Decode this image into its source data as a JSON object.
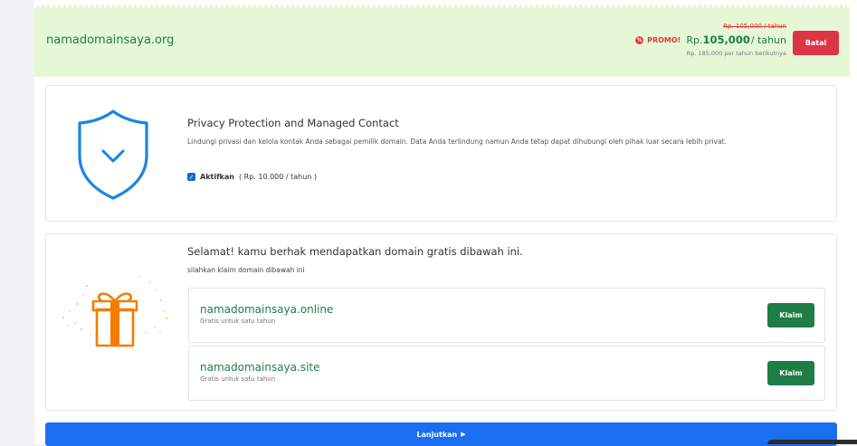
{
  "domain": {
    "name": "namadomainsaya.org",
    "old_price": "Rp. 105,000 / tahun",
    "promo_label": "PROMO!",
    "price_prefix": "Rp.",
    "price_value": "105,000",
    "price_suffix": "/ tahun",
    "renew_note": "Rp. 185,000 per tahun berikutnya",
    "cancel_label": "Batal"
  },
  "privacy": {
    "title": "Privacy Protection and Managed Contact",
    "description": "Lindungi privasi dan kelola kontak Anda sebagai pemilik domain. Data Anda terlindung namun Anda tetap dapat dihubungi oleh pihak luar secara lebih privat.",
    "checkbox_label": "Aktifkan",
    "checkbox_price": "( Rp. 10.000 / tahun )",
    "checked": true
  },
  "gift": {
    "title": "Selamat! kamu berhak mendapatkan domain gratis dibawah ini.",
    "subtitle": "silahkan klaim domain dibawah ini",
    "offers": [
      {
        "name": "namadomainsaya.online",
        "desc": "Gratis untuk satu tahun",
        "button": "Klaim"
      },
      {
        "name": "namadomainsaya.site",
        "desc": "Gratis untuk satu tahun",
        "button": "Klaim"
      }
    ]
  },
  "continue_label": "Lanjutkan",
  "colors": {
    "green": "#1e7d46",
    "blue": "#1a6ef0",
    "red": "#dc3545",
    "orange": "#f57c00"
  }
}
